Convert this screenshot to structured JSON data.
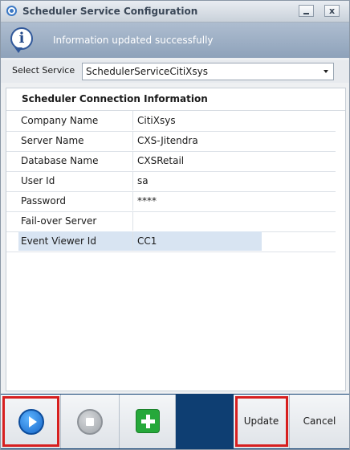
{
  "window": {
    "title": "Scheduler Service Configuration",
    "close_glyph": "x"
  },
  "info": {
    "message": "Information updated successfully",
    "icon_letter": "i"
  },
  "service": {
    "label": "Select Service",
    "selected": "SchedulerServiceCitiXsys"
  },
  "connection": {
    "title": "Scheduler Connection Information",
    "rows": [
      {
        "label": "Company Name",
        "value": "CitiXsys"
      },
      {
        "label": "Server Name",
        "value": "CXS-Jitendra"
      },
      {
        "label": "Database Name",
        "value": "CXSRetail"
      },
      {
        "label": "User Id",
        "value": "sa"
      },
      {
        "label": "Password",
        "value": "****"
      },
      {
        "label": "Fail-over Server",
        "value": ""
      },
      {
        "label": "Event Viewer Id",
        "value": "CC1"
      }
    ]
  },
  "toolbar": {
    "update_label": "Update",
    "cancel_label": "Cancel"
  },
  "colors": {
    "banner": "#9aadc4",
    "bottom_bar": "#0e3e72",
    "highlight": "#d71f1f",
    "selected_row": "#d8e4f2"
  }
}
